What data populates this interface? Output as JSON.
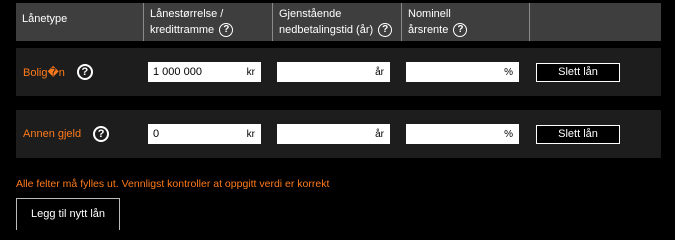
{
  "table": {
    "headers": [
      {
        "line1": "Lånetype",
        "line2": ""
      },
      {
        "line1": "Lånestørrelse /",
        "line2": "kredittramme"
      },
      {
        "line1": "Gjenstående",
        "line2": "nedbetalingstid (år)"
      },
      {
        "line1": "Nominell",
        "line2": "årsrente"
      }
    ],
    "help_glyph": "?",
    "rows": [
      {
        "label": "Bolig�n",
        "amount": "1 000 000",
        "amount_unit": "kr",
        "years": "",
        "years_unit": "år",
        "rate": "",
        "rate_unit": "%",
        "delete_label": "Slett lån"
      },
      {
        "label": "Annen gjeld",
        "amount": "0",
        "amount_unit": "kr",
        "years": "",
        "years_unit": "år",
        "rate": "",
        "rate_unit": "%",
        "delete_label": "Slett lån"
      }
    ]
  },
  "validation_message": "Alle felter må fylles ut. Vennligst kontroller at oppgitt verdi er korrekt",
  "add_button_label": "Legg til nytt lån",
  "colors": {
    "background": "#000000",
    "header_bg": "#3e3e3e",
    "row_bg": "#1d1d1d",
    "accent_orange": "#ff7a1a"
  }
}
